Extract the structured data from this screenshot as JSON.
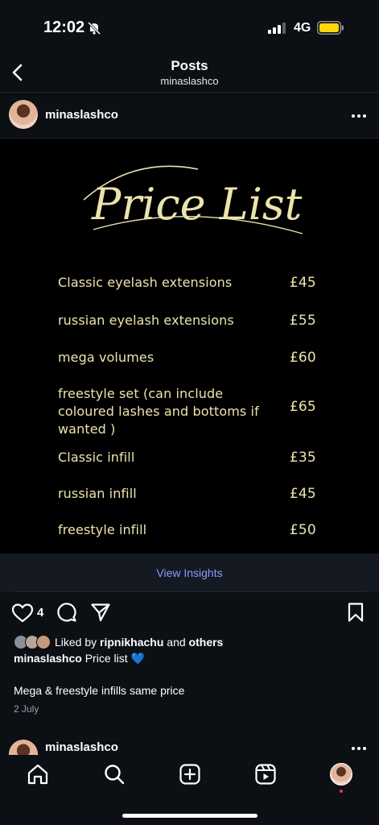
{
  "status_bar": {
    "time": "12:02",
    "network": "4G",
    "battery_color": "#ffd60a"
  },
  "nav": {
    "title": "Posts",
    "subtitle": "minaslashco"
  },
  "post": {
    "username": "minaslashco",
    "image": {
      "title": "Price List",
      "text_color": "#ece3ad",
      "items": [
        {
          "name": "Classic eyelash extensions",
          "price": "£45"
        },
        {
          "name": "russian eyelash extensions",
          "price": "£55"
        },
        {
          "name": "mega volumes",
          "price": "£60"
        },
        {
          "name": "freestyle set (can include coloured lashes and bottoms if wanted )",
          "price": "£65"
        },
        {
          "name": "Classic infill",
          "price": "£35"
        },
        {
          "name": "russian infill",
          "price": "£45"
        },
        {
          "name": "freestyle infill",
          "price": "£50"
        }
      ]
    },
    "insights_label": "View Insights",
    "like_count": "4",
    "liked_by_prefix": "Liked by",
    "liked_by_user": "ripnikhachu",
    "liked_by_and": "and",
    "liked_by_others": "others",
    "caption_user": "minaslashco",
    "caption_text": "Price list",
    "caption_emoji": "💙",
    "caption_second": "Mega & freestyle infills same price",
    "date": "2 July"
  },
  "next_post": {
    "username": "minaslashco"
  },
  "tabs": [
    "home-icon",
    "search-icon",
    "create-icon",
    "reels-icon",
    "profile-avatar"
  ]
}
